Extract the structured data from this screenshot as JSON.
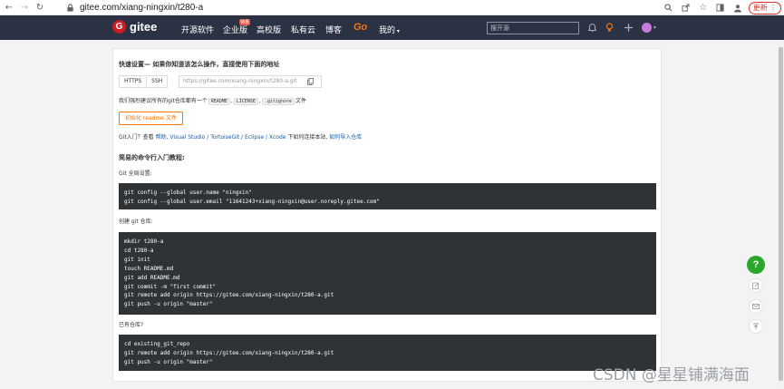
{
  "browser": {
    "url": "gitee.com/xiang-ningxin/t280-a",
    "update_label": "更新"
  },
  "nav": {
    "logo_letter": "G",
    "logo_text": "gitee",
    "items": [
      "开源软件",
      "企业版",
      "高校版",
      "私有云",
      "博客",
      "Go",
      "我的"
    ],
    "badge": "特惠",
    "search_placeholder": "搜开源"
  },
  "quick": {
    "heading": "快速设置— 如果你知道该怎么操作，直接使用下面的地址",
    "tab_https": "HTTPS",
    "tab_ssh": "SSH",
    "url_value": "https://gitee.com/xiang-ningxin/t280-a.git",
    "suggest_prefix": "我们强烈建议所有的git仓库都有一个",
    "file_readme": "README",
    "file_license": "LICENSE",
    "file_gitignore": ".gitignore",
    "suggest_suffix": "文件",
    "init_button": "初始化 readme 文件",
    "help_prefix": "Git入门？查看",
    "help_link": "帮助",
    "help_tools": ", Visual Studio / TortoiseGit / Eclipse / Xcode",
    "help_mid": "下如何连接本站,",
    "help_import": "如何导入仓库"
  },
  "tutorial": {
    "heading": "简易的命令行入门教程:",
    "global_label": "Git 全局设置:",
    "global_cmds": [
      "git config --global user.name \"ningxin\"",
      "git config --global user.email \"11641243+xiang-ningxin@user.noreply.gitee.com\""
    ],
    "create_label": "创建 git 仓库:",
    "create_cmds": [
      "mkdir t280-a",
      "cd t280-a",
      "git init",
      "touch README.md",
      "git add README.md",
      "git commit -m \"first commit\"",
      "git remote add origin https://gitee.com/xiang-ningxin/t280-a.git",
      "git push -u origin \"master\""
    ],
    "existing_label": "已有仓库?",
    "existing_cmds": [
      "cd existing_git_repo",
      "git remote add origin https://gitee.com/xiang-ningxin/t280-a.git",
      "git push -u origin \"master\""
    ]
  },
  "fab_label": "?",
  "watermark": "CSDN @星星铺满海面"
}
